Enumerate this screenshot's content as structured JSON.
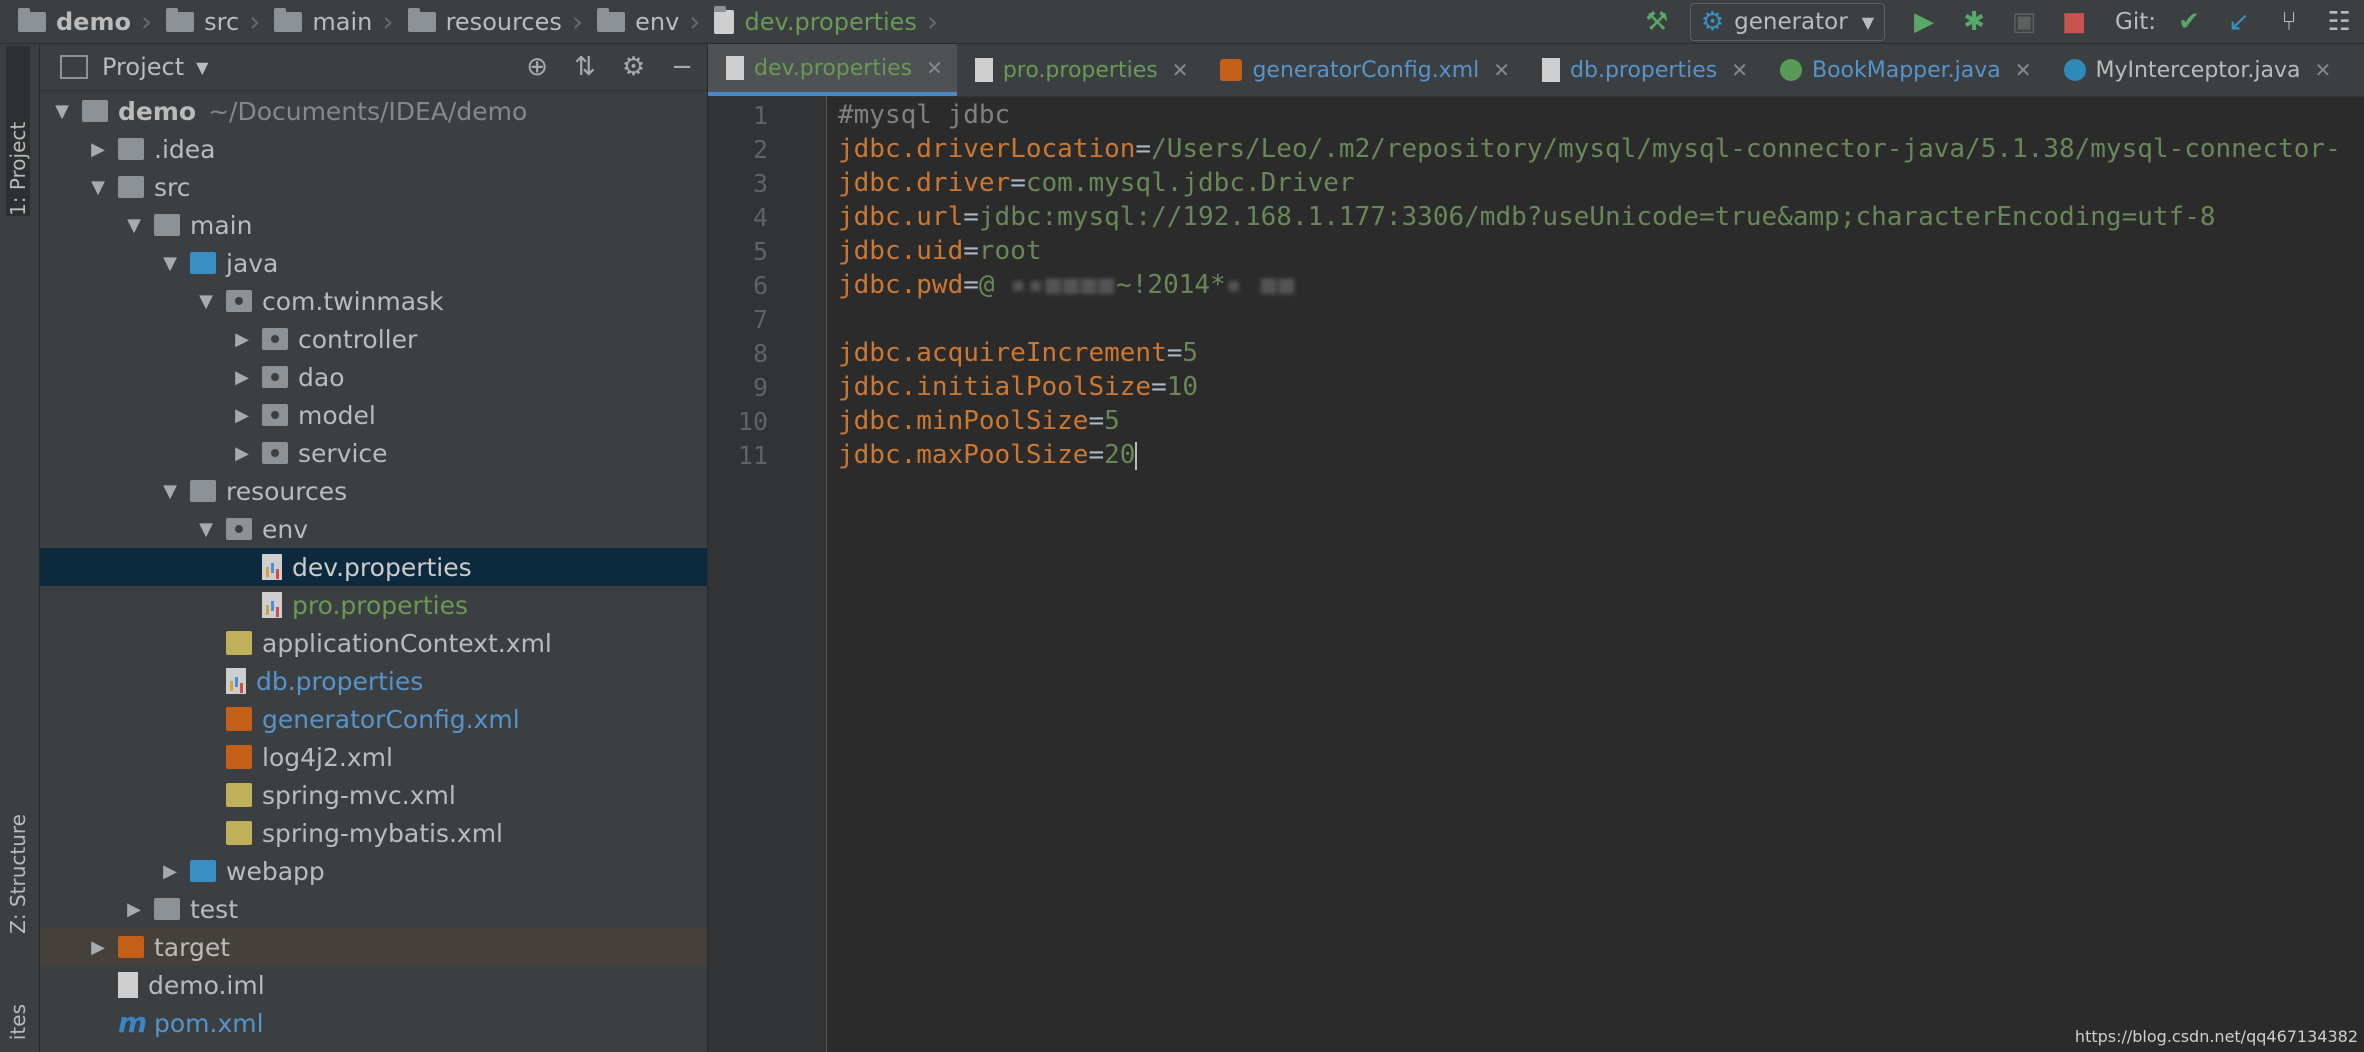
{
  "breadcrumbs": [
    {
      "label": "demo",
      "style": "bold"
    },
    {
      "label": "src"
    },
    {
      "label": "main"
    },
    {
      "label": "resources"
    },
    {
      "label": "env"
    },
    {
      "label": "dev.properties",
      "style": "active"
    }
  ],
  "toolbar": {
    "build_icon": "hammer-icon",
    "run_config": "generator",
    "git_label": "Git:"
  },
  "side_tabs": {
    "project": "1: Project",
    "structure": "Z: Structure",
    "favorites": "ites"
  },
  "project_panel": {
    "title": "Project",
    "tree": [
      {
        "label": "demo",
        "extra": "~/Documents/IDEA/demo"
      },
      {
        "label": ".idea"
      },
      {
        "label": "src"
      },
      {
        "label": "main"
      },
      {
        "label": "java"
      },
      {
        "label": "com.twinmask"
      },
      {
        "label": "controller"
      },
      {
        "label": "dao"
      },
      {
        "label": "model"
      },
      {
        "label": "service"
      },
      {
        "label": "resources"
      },
      {
        "label": "env"
      },
      {
        "label": "dev.properties"
      },
      {
        "label": "pro.properties"
      },
      {
        "label": "applicationContext.xml"
      },
      {
        "label": "db.properties"
      },
      {
        "label": "generatorConfig.xml"
      },
      {
        "label": "log4j2.xml"
      },
      {
        "label": "spring-mvc.xml"
      },
      {
        "label": "spring-mybatis.xml"
      },
      {
        "label": "webapp"
      },
      {
        "label": "test"
      },
      {
        "label": "target"
      },
      {
        "label": "demo.iml"
      },
      {
        "label": "pom.xml"
      }
    ]
  },
  "editor": {
    "tabs": [
      {
        "label": "dev.properties"
      },
      {
        "label": "pro.properties"
      },
      {
        "label": "generatorConfig.xml"
      },
      {
        "label": "db.properties"
      },
      {
        "label": "BookMapper.java"
      },
      {
        "label": "MyInterceptor.java"
      }
    ],
    "lines": [
      {
        "num": "1",
        "key": "",
        "sep": "",
        "value": "",
        "comment": "#mysql jdbc"
      },
      {
        "num": "2",
        "key": "jdbc.driverLocation",
        "sep": "=",
        "value": "/Users/Leo/.m2/repository/mysql/mysql-connector-java/5.1.38/mysql-connector-",
        "comment": ""
      },
      {
        "num": "3",
        "key": "jdbc.driver",
        "sep": "=",
        "value": "com.mysql.jdbc.Driver",
        "comment": ""
      },
      {
        "num": "4",
        "key": "jdbc.url",
        "sep": "=",
        "value": "jdbc:mysql://192.168.1.177:3306/mdb?useUnicode=true&amp;characterEncoding=utf-8",
        "comment": ""
      },
      {
        "num": "5",
        "key": "jdbc.uid",
        "sep": "=",
        "value": "root",
        "comment": ""
      },
      {
        "num": "6",
        "key": "jdbc.pwd",
        "sep": "=",
        "value": "@ ",
        "value2": "~!2014*",
        "comment": ""
      },
      {
        "num": "7",
        "key": "",
        "sep": "",
        "value": "",
        "comment": ""
      },
      {
        "num": "8",
        "key": "jdbc.acquireIncrement",
        "sep": "=",
        "value": "5",
        "comment": ""
      },
      {
        "num": "9",
        "key": "jdbc.initialPoolSize",
        "sep": "=",
        "value": "10",
        "comment": ""
      },
      {
        "num": "10",
        "key": "jdbc.minPoolSize",
        "sep": "=",
        "value": "5",
        "comment": ""
      },
      {
        "num": "11",
        "key": "jdbc.maxPoolSize",
        "sep": "=",
        "value": "20",
        "comment": ""
      }
    ]
  },
  "watermark": "https://blog.csdn.net/qq467134382",
  "colors": {
    "key": "#cc7832",
    "value": "#6a8759",
    "comment": "#808080",
    "selected_row": "#0d293e",
    "active_tab_underline": "#4a88c7"
  }
}
